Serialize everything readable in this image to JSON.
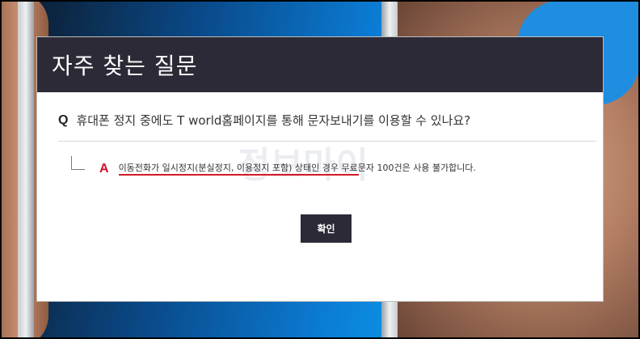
{
  "dialog": {
    "title": "자주 찾는 질문",
    "question_marker": "Q",
    "question": "휴대폰 정지 중에도 T world홈페이지를 통해 문자보내기를 이용할 수 있나요?",
    "answer_marker": "A",
    "answer": "이동전화가 일시정지(분실정지, 이용정지 포함) 상태인 경우 무료문자 100건은 사용 불가합니다.",
    "confirm_label": "확인"
  },
  "watermark": {
    "text": "정보마이"
  },
  "colors": {
    "header_bg": "#2b2a36",
    "answer_marker": "#d0112b",
    "underline": "#d21b26",
    "button_bg": "#2b2a36"
  },
  "icons": {
    "reply": "reply-arrow-icon"
  }
}
